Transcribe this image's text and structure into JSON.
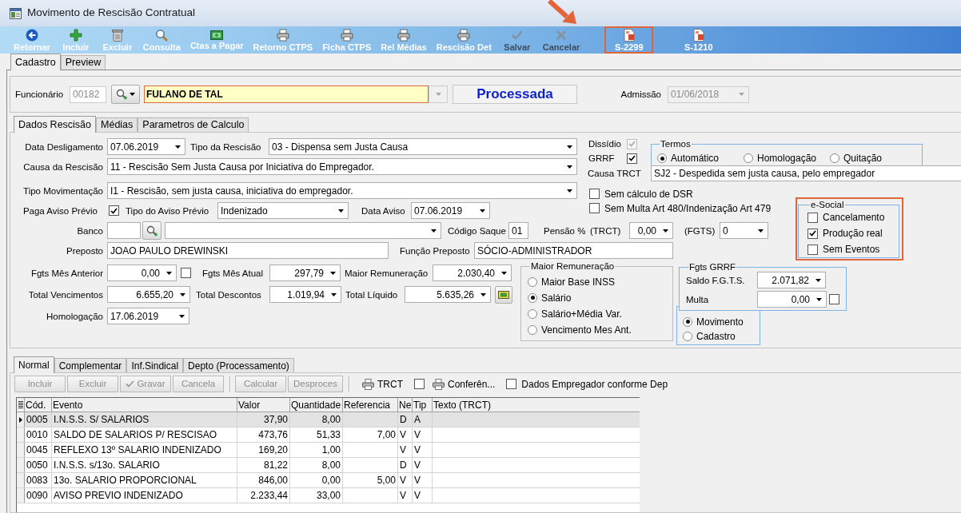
{
  "window": {
    "title": "Movimento de Rescisão Contratual"
  },
  "toolbar": [
    {
      "label": "Retornar",
      "kind": "back",
      "disabled": false,
      "highlighted": false
    },
    {
      "label": "Incluir",
      "kind": "add",
      "disabled": false,
      "highlighted": false
    },
    {
      "label": "Excluir",
      "kind": "delete",
      "disabled": false,
      "highlighted": false
    },
    {
      "label": "Consulta",
      "kind": "search",
      "disabled": false,
      "highlighted": false
    },
    {
      "label": "Ctas a Pagar",
      "kind": "money",
      "disabled": false,
      "highlighted": false
    },
    {
      "label": "Retorno CTPS",
      "kind": "print",
      "disabled": false,
      "highlighted": false
    },
    {
      "label": "Ficha CTPS",
      "kind": "print",
      "disabled": false,
      "highlighted": false
    },
    {
      "label": "Rel Médias",
      "kind": "print",
      "disabled": false,
      "highlighted": false
    },
    {
      "label": "Rescisão Det",
      "kind": "print",
      "disabled": false,
      "highlighted": false
    },
    {
      "label": "Salvar",
      "kind": "save",
      "disabled": true,
      "highlighted": false
    },
    {
      "label": "Cancelar",
      "kind": "cancel",
      "disabled": true,
      "highlighted": false
    },
    {
      "label": "S-2299",
      "kind": "esocial",
      "disabled": false,
      "highlighted": true
    },
    {
      "label": "S-1210",
      "kind": "esocial",
      "disabled": false,
      "highlighted": false
    }
  ],
  "main_tabs": [
    {
      "label": "Cadastro",
      "selected": true
    },
    {
      "label": "Preview",
      "selected": false
    }
  ],
  "employee": {
    "label": "Funcionário",
    "code": {
      "value": "00182",
      "disabled": true
    },
    "name": {
      "value": "FULANO DE TAL",
      "highlighted": true
    },
    "status": "Processada",
    "admission": {
      "label": "Admissão",
      "value": "01/06/2018",
      "disabled": true
    }
  },
  "detail_tabs": [
    {
      "label": "Dados Rescisão",
      "selected": true
    },
    {
      "label": "Médias",
      "selected": false
    },
    {
      "label": "Parametros de Calculo",
      "selected": false
    }
  ],
  "rescisao": {
    "data_desligamento": {
      "label": "Data Desligamento",
      "value": "07.06.2019"
    },
    "tipo_rescisao": {
      "label": "Tipo da Rescisão",
      "value": "03 - Dispensa sem Justa Causa"
    },
    "causa_rescisao": {
      "label": "Causa da Rescisão",
      "value": "11 - Rescisão Sem Justa Causa por Iniciativa do Empregador."
    },
    "tipo_movimentacao": {
      "label": "Tipo Movimentação",
      "value": "I1 - Rescisão, sem justa causa, iniciativa do empregador."
    },
    "paga_aviso_previo": {
      "label": "Paga Aviso Prévio",
      "checked": true
    },
    "tipo_aviso_previo": {
      "label": "Tipo do Aviso Prévio",
      "value": "Indenizado"
    },
    "data_aviso": {
      "label": "Data Aviso",
      "value": "07.06.2019"
    },
    "banco": {
      "label": "Banco"
    },
    "codigo_saque": {
      "label": "Código Saque",
      "value": "01"
    },
    "pensao": {
      "label": "Pensão %",
      "trct_label": "(TRCT)",
      "trct_value": "0,00",
      "fgts_label": "(FGTS)",
      "fgts_value": "0"
    },
    "preposto": {
      "label": "Preposto",
      "value": "JOAO PAULO DREWINSKI"
    },
    "funcao_preposto": {
      "label": "Função Preposto",
      "value": "SÓCIO-ADMINISTRADOR"
    },
    "fgts_mes_anterior": {
      "label": "Fgts Mês Anterior",
      "value": "0,00",
      "checked": false
    },
    "fgts_mes_atual": {
      "label": "Fgts Mês Atual",
      "value": "297,79"
    },
    "maior_remuneracao": {
      "label": "Maior Remuneração",
      "value": "2.030,40"
    },
    "total_vencimentos": {
      "label": "Total Vencimentos",
      "value": "6.655,20"
    },
    "total_descontos": {
      "label": "Total Descontos",
      "value": "1.019,94"
    },
    "total_liquido": {
      "label": "Total Líquido",
      "value": "5.635,26"
    },
    "homologacao": {
      "label": "Homologação",
      "value": "17.06.2019"
    },
    "dissidio": {
      "label": "Dissídio",
      "checked": true,
      "disabled": true
    },
    "grrf": {
      "label": "GRRF",
      "checked": true
    },
    "termos": {
      "title": "Termos",
      "options": [
        {
          "label": "Automático",
          "selected": true
        },
        {
          "label": "Homologação",
          "selected": false
        },
        {
          "label": "Quitação",
          "selected": false
        }
      ]
    },
    "causa_trct": {
      "label": "Causa TRCT",
      "value": "SJ2 - Despedida sem justa causa, pelo empregador"
    },
    "sem_calculo_dsr": {
      "label": "Sem cálculo de DSR",
      "checked": false
    },
    "sem_multa": {
      "label": "Sem Multa Art 480/Indenização Art 479",
      "checked": false
    },
    "esocial": {
      "title": "e-Social",
      "highlighted": true,
      "options": [
        {
          "label": "Cancelamento",
          "checked": false
        },
        {
          "label": "Produção real",
          "checked": true
        },
        {
          "label": "Sem Eventos",
          "checked": false
        }
      ]
    },
    "maior_remuneracao_base": {
      "title": "Maior Remuneração",
      "options": [
        {
          "label": "Maior Base INSS",
          "selected": false
        },
        {
          "label": "Salário",
          "selected": true
        },
        {
          "label": "Salário+Média Var.",
          "selected": false
        },
        {
          "label": "Vencimento Mes Ant.",
          "selected": false
        }
      ]
    },
    "fgts_grrf": {
      "title": "Fgts GRRF",
      "saldo": {
        "label": "Saldo F.G.T.S.",
        "value": "2.071,82"
      },
      "multa": {
        "label": "Multa",
        "value": "0,00",
        "checked": false
      }
    },
    "origem": {
      "options": [
        {
          "label": "Movimento",
          "selected": true
        },
        {
          "label": "Cadastro",
          "selected": false
        }
      ]
    }
  },
  "event_tabs": [
    {
      "label": "Normal",
      "selected": true
    },
    {
      "label": "Complementar",
      "selected": false
    },
    {
      "label": "Inf.Sindical",
      "selected": false
    },
    {
      "label": "Depto (Processamento)",
      "selected": false
    }
  ],
  "event_toolbar": [
    {
      "kind": "button",
      "label": "Incluir",
      "disabled": true
    },
    {
      "kind": "button",
      "label": "Excluir",
      "disabled": true
    },
    {
      "kind": "confirm",
      "label": "Gravar",
      "disabled": true
    },
    {
      "kind": "button",
      "label": "Cancela",
      "disabled": true
    },
    {
      "kind": "separator"
    },
    {
      "kind": "button",
      "label": "Calcular",
      "disabled": true
    },
    {
      "kind": "button",
      "label": "Desproces",
      "disabled": true
    },
    {
      "kind": "separator"
    },
    {
      "kind": "print",
      "label": "TRCT",
      "disabled": false
    },
    {
      "kind": "checkbox",
      "checked": false
    },
    {
      "kind": "print",
      "label": "Conferên...",
      "disabled": false
    },
    {
      "kind": "checkbox",
      "label": "Dados Empregador conforme Dep",
      "checked": false
    }
  ],
  "grid": {
    "columns": [
      "Cód.",
      "Evento",
      "Valor",
      "Quantidade",
      "Referencia",
      "Ne",
      "Tip",
      "Texto (TRCT)"
    ],
    "rows": [
      {
        "selected": true,
        "cod": "0005",
        "evento": "I.N.S.S. S/ SALARIOS",
        "valor": "37,90",
        "quantidade": "8,00",
        "ne": "D",
        "tipo": "A"
      },
      {
        "selected": false,
        "cod": "0010",
        "evento": "SALDO DE SALARIOS P/ RESCISAO",
        "valor": "473,76",
        "quantidade": "51,33",
        "referencia": "7,00",
        "ne": "V",
        "tipo": "V"
      },
      {
        "selected": false,
        "cod": "0045",
        "evento": "REFLEXO 13º SALARIO INDENIZADO",
        "valor": "169,20",
        "quantidade": "1,00",
        "ne": "V",
        "tipo": "V"
      },
      {
        "selected": false,
        "cod": "0050",
        "evento": "I.N.S.S. s/13o. SALARIO",
        "valor": "81,22",
        "quantidade": "8,00",
        "ne": "D",
        "tipo": "V"
      },
      {
        "selected": false,
        "cod": "0083",
        "evento": "13o. SALARIO PROPORCIONAL",
        "valor": "846,00",
        "quantidade": "0,00",
        "referencia": "5,00",
        "ne": "V",
        "tipo": "V"
      },
      {
        "selected": false,
        "cod": "0090",
        "evento": "AVISO PREVIO INDENIZADO",
        "valor": "2.233,44",
        "quantidade": "33,00",
        "ne": "V",
        "tipo": "V"
      }
    ]
  }
}
